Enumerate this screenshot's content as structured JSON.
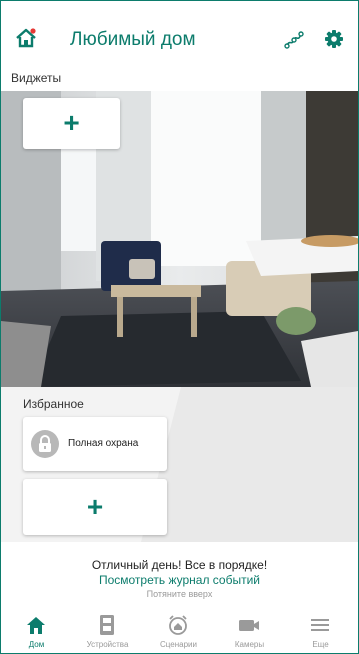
{
  "header": {
    "title": "Любимый дом",
    "home_icon": "home-alert-icon",
    "graph_icon": "graph-icon",
    "settings_icon": "gear-icon",
    "accent_color": "#0c7c6c",
    "notification_dot_color": "#e53935"
  },
  "widgets": {
    "label": "Виджеты",
    "add_icon": "plus-icon"
  },
  "favorites": {
    "label": "Избранное",
    "items": [
      {
        "label": "Полная охрана",
        "icon": "lock-icon"
      }
    ],
    "add_icon": "plus-icon"
  },
  "status": {
    "message": "Отличный день! Все в порядке!",
    "link": "Посмотреть журнал событий",
    "hint": "Потяните вверх"
  },
  "nav": {
    "items": [
      {
        "label": "Дом",
        "icon": "home-icon",
        "active": true
      },
      {
        "label": "Устройства",
        "icon": "devices-icon",
        "active": false
      },
      {
        "label": "Сценарии",
        "icon": "alarm-scenario-icon",
        "active": false
      },
      {
        "label": "Камеры",
        "icon": "camera-icon",
        "active": false
      },
      {
        "label": "Еще",
        "icon": "menu-icon",
        "active": false
      }
    ]
  }
}
